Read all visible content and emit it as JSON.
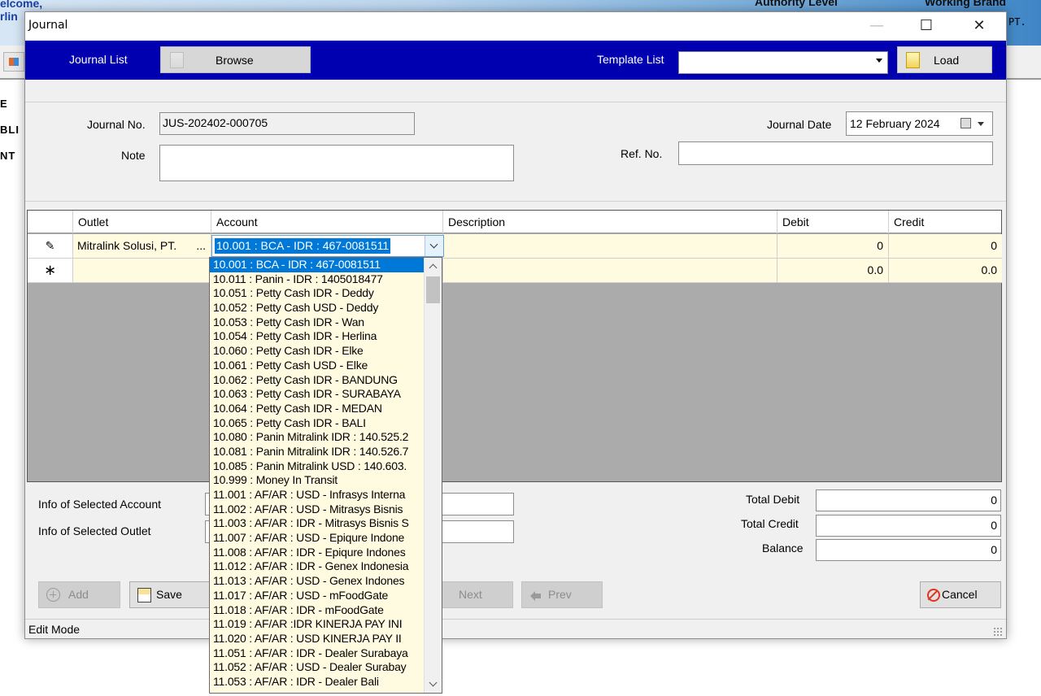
{
  "background": {
    "welcome_line1": "elcome,",
    "welcome_line2": "rlin",
    "authority_label": "Authority Level",
    "working_brand_label": "Working Brand",
    "brand_value": "PT.",
    "left_items": [
      "E",
      "BLI",
      "NT"
    ]
  },
  "dialog": {
    "title": "Journal",
    "window_controls": {
      "minimize": "—",
      "maximize": "☐",
      "close": "✕"
    },
    "toolbar": {
      "journal_list_label": "Journal List",
      "browse_button": "Browse",
      "template_list_label": "Template List",
      "template_value": "",
      "load_button": "Load"
    },
    "form": {
      "journal_no_label": "Journal No.",
      "journal_no_value": "JUS-202402-000705",
      "note_label": "Note",
      "note_value": "",
      "journal_date_label": "Journal Date",
      "journal_date_value": "12  February  2024",
      "ref_no_label": "Ref. No.",
      "ref_no_value": ""
    },
    "grid": {
      "columns": [
        "Outlet",
        "Account",
        "Description",
        "Debit",
        "Credit"
      ],
      "rows": [
        {
          "indicator": "✎",
          "outlet": "Mitralink Solusi, PT.",
          "outlet_more": "...",
          "account": "10.001 : BCA - IDR : 467-0081511",
          "description": "",
          "debit": "0",
          "credit": "0"
        },
        {
          "indicator": "∗",
          "outlet": "",
          "account": "",
          "description": "",
          "debit": "0.0",
          "credit": "0.0"
        }
      ]
    },
    "account_dropdown": {
      "selected_index": 0,
      "items": [
        "10.001 : BCA - IDR : 467-0081511",
        "10.011 : Panin - IDR : 1405018477",
        "10.051 : Petty Cash IDR - Deddy",
        "10.052 : Petty Cash USD - Deddy",
        "10.053 : Petty Cash IDR - Wan",
        "10.054 : Petty Cash IDR - Herlina",
        "10.060 : Petty Cash IDR - Elke",
        "10.061 : Petty Cash USD - Elke",
        "10.062 : Petty Cash IDR - BANDUNG",
        "10.063 : Petty Cash IDR - SURABAYA",
        "10.064 : Petty Cash IDR - MEDAN",
        "10.065 : Petty Cash IDR - BALI",
        "10.080 : Panin Mitralink IDR : 140.525.2",
        "10.081 : Panin Mitralink IDR : 140.526.7",
        "10.085 : Panin Mitralink USD : 140.603.",
        "10.999 : Money In Transit",
        "11.001 : AF/AR : USD - Infrasys Interna",
        "11.002 : AF/AR : USD - Mitrasys Bisnis",
        "11.003 : AF/AR : IDR - Mitrasys Bisnis S",
        "11.007 : AF/AR : USD - Epiqure Indone",
        "11.008 : AF/AR : IDR - Epiqure Indones",
        "11.012 : AF/AR : IDR - Genex Indonesia",
        "11.013 : AF/AR : USD - Genex Indones",
        "11.017 : AF/AR : USD - mFoodGate",
        "11.018 : AF/AR : IDR - mFoodGate",
        "11.019 : AF/AR :IDR KINERJA PAY INI",
        "11.020 : AF/AR : USD KINERJA PAY II",
        "11.051 : AF/AR : IDR - Dealer Surabaya",
        "11.052 : AF/AR : USD - Dealer Surabay",
        "11.053 : AF/AR : IDR - Dealer Bali"
      ]
    },
    "info": {
      "selected_account_label": "Info of Selected Account",
      "selected_outlet_label": "Info of Selected Outlet",
      "total_debit_label": "Total Debit",
      "total_debit_value": "0",
      "total_credit_label": "Total Credit",
      "total_credit_value": "0",
      "balance_label": "Balance",
      "balance_value": "0"
    },
    "buttons": {
      "add": "Add",
      "save": "Save",
      "next": "Next",
      "prev": "Prev",
      "cancel": "Cancel"
    },
    "status": "Edit Mode"
  },
  "colors": {
    "toolbar_blue": "#0000b0",
    "selection_blue": "#0078d7",
    "row_yellow": "#fffbe1",
    "grid_grey": "#ababab",
    "cancel_red": "#e0341e"
  }
}
